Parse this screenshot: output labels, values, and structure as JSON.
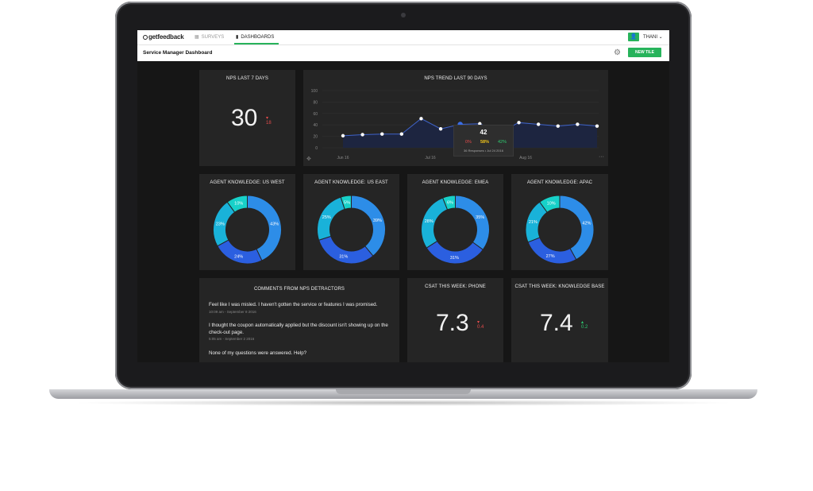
{
  "topbar": {
    "logo": "getfeedback",
    "tabs": [
      {
        "label": "SURVEYS",
        "icon": "grid-icon"
      },
      {
        "label": "DASHBOARDS",
        "icon": "bar-chart-icon"
      }
    ],
    "user": "THANI"
  },
  "subbar": {
    "title": "Service Manager Dashboard",
    "new_tile": "NEW TILE"
  },
  "nps7": {
    "title": "NPS LAST 7 DAYS",
    "value": "30",
    "delta": "18"
  },
  "trend": {
    "title": "NPS TREND LAST 90 DAYS",
    "tooltip": {
      "value": "42",
      "detractors": "0%",
      "passives": "58%",
      "promoters": "42%",
      "note": "36 Responses • Jul 24 2016"
    }
  },
  "chart_data": [
    {
      "type": "line",
      "title": "NPS TREND LAST 90 DAYS",
      "ylim": [
        0,
        100
      ],
      "yticks": [
        0,
        20,
        40,
        60,
        80,
        100
      ],
      "xtick_labels": [
        "Jun 16",
        "Jul 16",
        "Aug 16"
      ],
      "series": [
        {
          "values": [
            21,
            23,
            24,
            24,
            51,
            33,
            41,
            42,
            27,
            44,
            41,
            38,
            41,
            38
          ]
        }
      ],
      "grid": true
    },
    {
      "type": "pie",
      "title": "AGENT KNOWLEDGE: US WEST",
      "values": [
        43,
        24,
        23,
        10
      ]
    },
    {
      "type": "pie",
      "title": "AGENT KNOWLEDGE: US EAST",
      "values": [
        39,
        31,
        25,
        5
      ]
    },
    {
      "type": "pie",
      "title": "AGENT KNOWLEDGE: EMEA",
      "values": [
        35,
        31,
        28,
        6
      ]
    },
    {
      "type": "pie",
      "title": "AGENT KNOWLEDGE: APAC",
      "values": [
        42,
        27,
        21,
        10
      ]
    }
  ],
  "donuts": [
    {
      "title": "AGENT KNOWLEDGE: US WEST",
      "labels": [
        "43%",
        "24%",
        "23%",
        "10%"
      ]
    },
    {
      "title": "AGENT KNOWLEDGE: US EAST",
      "labels": [
        "39%",
        "31%",
        "25%",
        "5%"
      ]
    },
    {
      "title": "AGENT KNOWLEDGE: EMEA",
      "labels": [
        "35%",
        "31%",
        "28%",
        "6%"
      ]
    },
    {
      "title": "AGENT KNOWLEDGE: APAC",
      "labels": [
        "42%",
        "27%",
        "21%",
        "10%"
      ]
    }
  ],
  "donut_colors": [
    "#2d8de8",
    "#2b5fe0",
    "#19b2d9",
    "#17d1c9"
  ],
  "comments": {
    "title": "COMMENTS FROM NPS DETRACTORS",
    "items": [
      {
        "text": "Feel like I was misled. I haven't gotten the service or features I was promised.",
        "time": "10:09 am - September 8 2016"
      },
      {
        "text": "I thought the coupon automatically applied but the discount isn't showing up on the check-out page.",
        "time": "5:05 am - September 2 2016"
      },
      {
        "text": "None of my questions were answered. Help?",
        "time": ""
      }
    ]
  },
  "csat_phone": {
    "title": "CSAT THIS WEEK: PHONE",
    "value": "7.3",
    "delta": "0.4"
  },
  "csat_kb": {
    "title": "CSAT THIS WEEK: KNOWLEDGE BASE",
    "value": "7.4",
    "delta": "0.2"
  }
}
